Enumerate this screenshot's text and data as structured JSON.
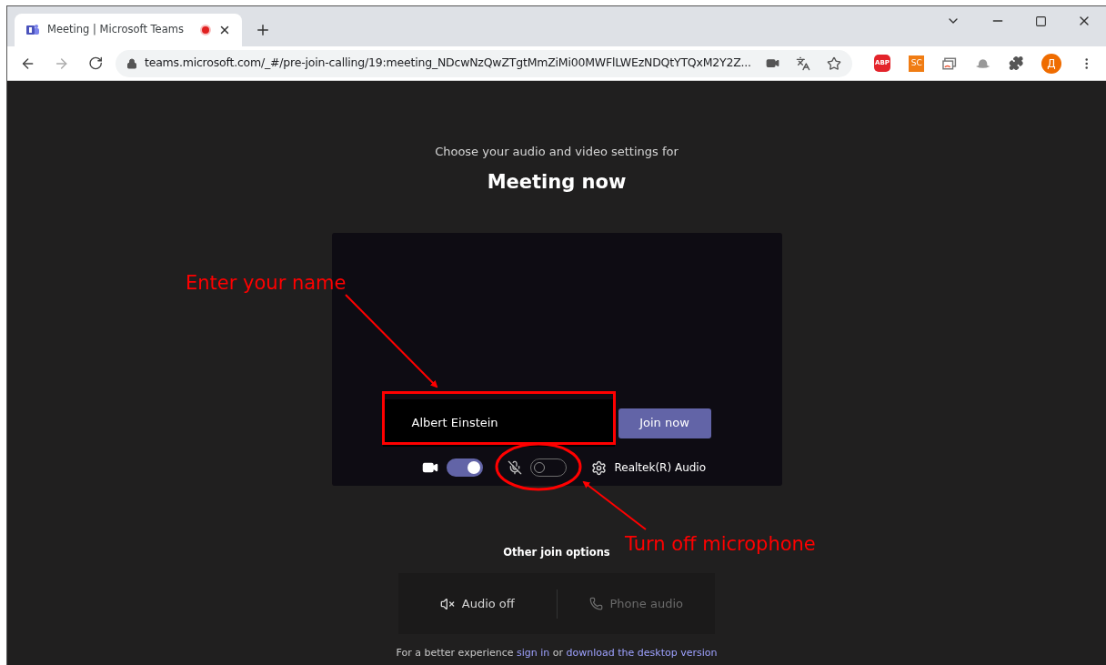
{
  "browser": {
    "tab": {
      "title": "Meeting | Microsoft Teams",
      "recording": true
    },
    "url": "teams.microsoft.com/_#/pre-join-calling/19:meeting_NDcwNzQwZTgtMmZiMi00MWFlLWEzNDQtYTQxM2Y2Z...",
    "extensions": [
      {
        "kind": "abp",
        "label": "ABP"
      },
      {
        "kind": "sc",
        "label": "SC"
      },
      {
        "kind": "cast"
      },
      {
        "kind": "hat"
      },
      {
        "kind": "puzzle"
      }
    ],
    "profile": "Д"
  },
  "prejoin": {
    "subtitle": "Choose your audio and video settings for",
    "title": "Meeting now",
    "name_value": "Albert Einstein",
    "join_button": "Join now",
    "camera_on": true,
    "mic_on": false,
    "audio_device": "Realtek(R) Audio"
  },
  "other_options": {
    "heading": "Other join options",
    "options": [
      {
        "label": "Audio off",
        "kind": "audio_off",
        "disabled": false
      },
      {
        "label": "Phone audio",
        "kind": "phone",
        "disabled": true
      }
    ]
  },
  "footer": {
    "prefix": "For a better experience",
    "link1": "sign in",
    "middle": "or",
    "link2": "download the desktop version"
  },
  "annotations": [
    {
      "kind": "name",
      "text": "Enter your name"
    },
    {
      "kind": "mic",
      "text": "Turn off microphone"
    }
  ]
}
